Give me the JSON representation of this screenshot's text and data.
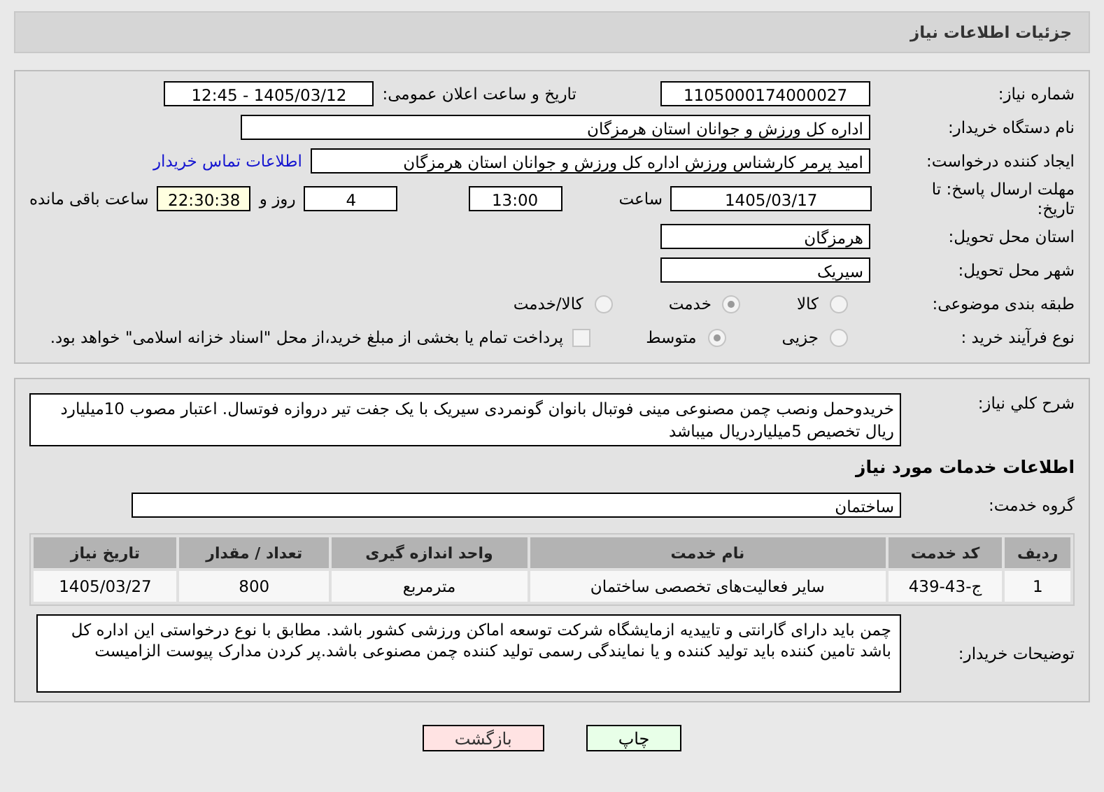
{
  "header": {
    "title": "جزئیات اطلاعات نیاز"
  },
  "need_info": {
    "need_number": {
      "label": "شماره نیاز:",
      "value": "1105000174000027"
    },
    "announce_datetime": {
      "label": "تاریخ و ساعت اعلان عمومی:",
      "value": "1405/03/12 - 12:45"
    },
    "buyer_org": {
      "label": "نام دستگاه خریدار:",
      "value": "اداره کل ورزش و جوانان استان هرمزگان"
    },
    "requester": {
      "label": "ایجاد کننده درخواست:",
      "value": "امید پرمر کارشناس ورزش اداره کل ورزش و جوانان استان هرمزگان",
      "link": "اطلاعات تماس خریدار"
    },
    "deadline": {
      "label": "مهلت ارسال پاسخ: تا تاریخ:",
      "date": "1405/03/17",
      "time_label": "ساعت",
      "time": "13:00",
      "days": "4",
      "days_label": "روز و",
      "remaining": "22:30:38",
      "remaining_label": "ساعت باقی مانده"
    },
    "province": {
      "label": "استان محل تحویل:",
      "value": "هرمزگان"
    },
    "city": {
      "label": "شهر محل تحویل:",
      "value": "سیریک"
    },
    "category": {
      "label": "طبقه بندی موضوعی:",
      "options": [
        {
          "label": "کالا",
          "selected": false
        },
        {
          "label": "خدمت",
          "selected": true
        },
        {
          "label": "کالا/خدمت",
          "selected": false
        }
      ]
    },
    "process": {
      "label": "نوع فرآیند خرید :",
      "options": [
        {
          "label": "جزیی",
          "selected": false
        },
        {
          "label": "متوسط",
          "selected": true
        }
      ],
      "treasury": {
        "checked": false,
        "text": "پرداخت تمام یا بخشی از مبلغ خرید،از محل \"اسناد خزانه اسلامی\" خواهد بود."
      }
    }
  },
  "description": {
    "label": "شرح کلي نیاز:",
    "value": "خریدوحمل ونصب چمن مصنوعی مینی فوتبال بانوان گونمردی سیریک با یک جفت تیر دروازه فوتسال. اعتبار مصوب 10میلیارد ریال تخصیص 5میلیاردریال  میباشد"
  },
  "services": {
    "title": "اطلاعات خدمات مورد نیاز",
    "group": {
      "label": "گروه خدمت:",
      "value": "ساختمان"
    },
    "table": {
      "columns": [
        "ردیف",
        "کد خدمت",
        "نام خدمت",
        "واحد اندازه گیری",
        "تعداد / مقدار",
        "تاریخ نیاز"
      ],
      "rows": [
        [
          "1",
          "ج-43-439",
          "سایر فعالیت‌های تخصصی ساختمان",
          "مترمربع",
          "800",
          "1405/03/27"
        ]
      ]
    },
    "buyer_notes": {
      "label": "توضیحات خریدار:",
      "value": "چمن باید دارای گارانتی و تاییدیه ازمایشگاه شرکت توسعه اماکن ورزشی کشور باشد. مطابق با نوع درخواستی این اداره کل باشد تامین کننده باید تولید کننده و یا نمایندگی رسمی تولید کننده چمن مصنوعی باشد.پر کردن مدارک پیوست الزامیست"
    }
  },
  "buttons": [
    {
      "kind": "print",
      "label": "چاپ"
    },
    {
      "kind": "back",
      "label": "بازگشت"
    }
  ]
}
